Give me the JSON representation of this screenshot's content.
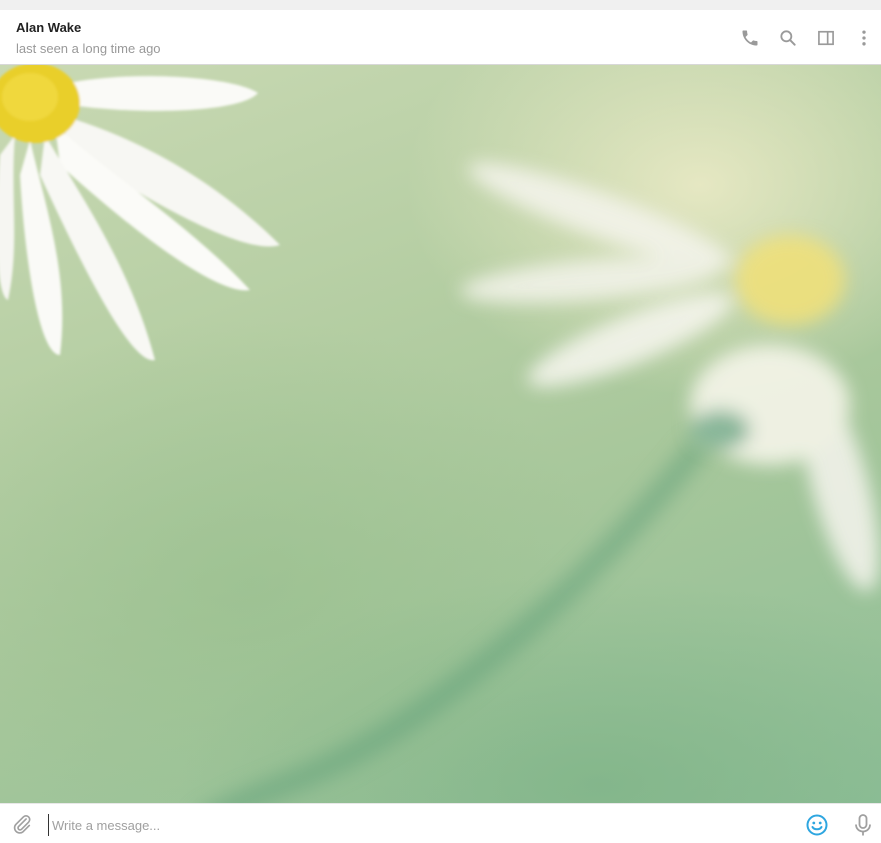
{
  "header": {
    "peer_name": "Alan Wake",
    "peer_status": "last seen a long time ago",
    "icons": [
      "phone-icon",
      "search-icon",
      "sidebar-toggle-icon",
      "more-vertical-icon"
    ]
  },
  "composer": {
    "placeholder": "Write a message...",
    "value": "",
    "icons": [
      "paperclip-icon",
      "emoji-icon",
      "microphone-icon"
    ]
  },
  "colors": {
    "icon_gray": "#999999",
    "accent_blue": "#2ea6e0",
    "name_text": "#222222",
    "status_text": "#999999"
  }
}
